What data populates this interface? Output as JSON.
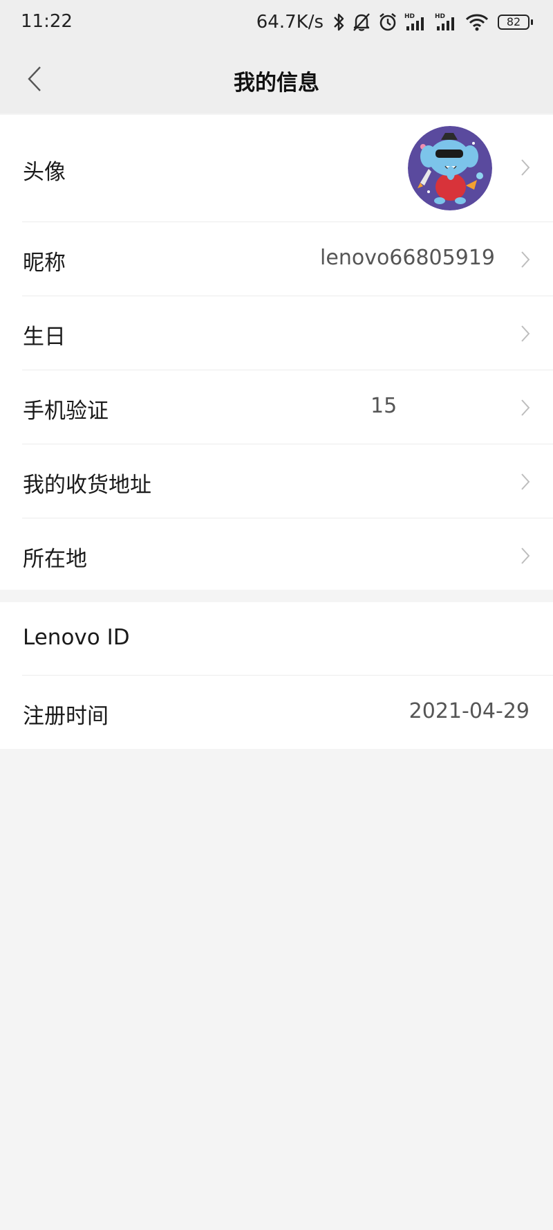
{
  "status_bar": {
    "time": "11:22",
    "network_speed": "64.7K/s",
    "icons": [
      "bluetooth-icon",
      "mute-icon",
      "alarm-icon",
      "hd-signal-icon",
      "hd-signal-icon",
      "wifi-icon"
    ],
    "battery": "82"
  },
  "header": {
    "back_icon": "chevron-left-icon",
    "title": "我的信息"
  },
  "profile_rows": [
    {
      "label": "头像",
      "value": "",
      "type": "avatar",
      "chevron": true
    },
    {
      "label": "昵称",
      "value": "lenovo66805919",
      "chevron": true
    },
    {
      "label": "生日",
      "value": "",
      "chevron": true
    },
    {
      "label": "手机验证",
      "value": "15",
      "chevron": true
    },
    {
      "label": "我的收货地址",
      "value": "",
      "chevron": true
    },
    {
      "label": "所在地",
      "value": "",
      "chevron": true
    }
  ],
  "account_rows": [
    {
      "label": "Lenovo ID",
      "value": ""
    },
    {
      "label": "注册时间",
      "value": "2021-04-29"
    }
  ],
  "colors": {
    "header_bg": "#eeeeee",
    "page_bg": "#f4f4f4",
    "row_bg": "#ffffff",
    "divider": "#ececec",
    "chevron": "#bdbdbd",
    "avatar_bg": "#5a4a9e"
  }
}
